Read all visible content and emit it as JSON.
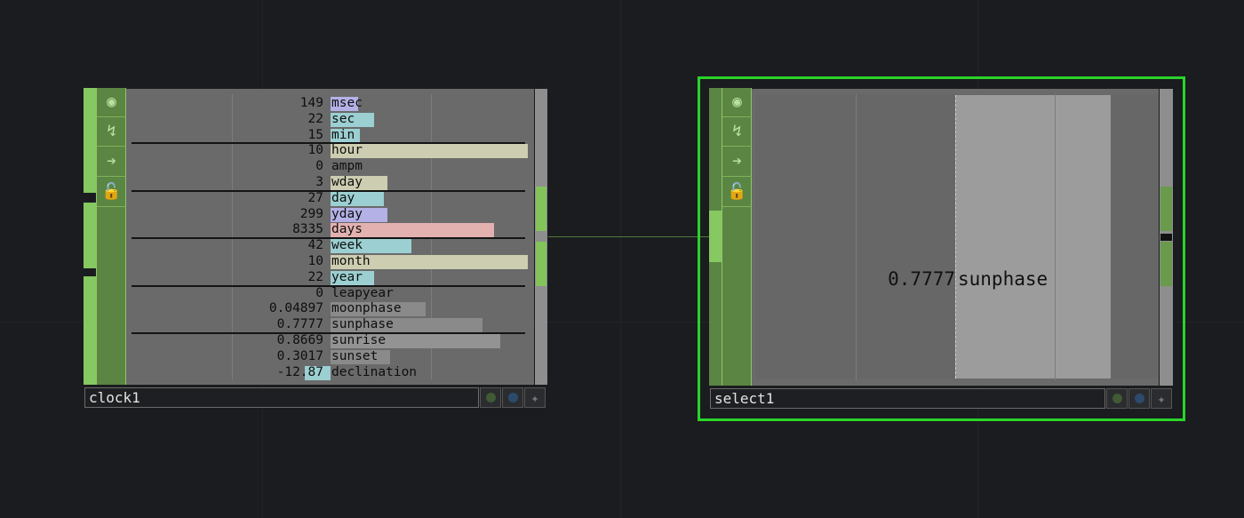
{
  "clock": {
    "name": "clock1",
    "channels": [
      {
        "value": "149",
        "name": "msec",
        "fill": 0.14,
        "color": "#b4b1e6"
      },
      {
        "value": "22",
        "name": "sec",
        "fill": 0.22,
        "color": "#9ccfd1"
      },
      {
        "value": "15",
        "name": "min",
        "fill": 0.15,
        "color": "#9ccfd1"
      },
      {
        "value": "10",
        "name": "hour",
        "fill": 1.0,
        "color": "#cdcdb1"
      },
      {
        "value": "0",
        "name": "ampm",
        "fill": 0.0,
        "color": "#cdcdb1"
      },
      {
        "value": "3",
        "name": "wday",
        "fill": 0.29,
        "color": "#cdcdb1"
      },
      {
        "value": "27",
        "name": "day",
        "fill": 0.27,
        "color": "#9ccfd1"
      },
      {
        "value": "299",
        "name": "yday",
        "fill": 0.29,
        "color": "#b4b1e6"
      },
      {
        "value": "8335",
        "name": "days",
        "fill": 0.83,
        "color": "#e4b1b1"
      },
      {
        "value": "42",
        "name": "week",
        "fill": 0.41,
        "color": "#9ccfd1"
      },
      {
        "value": "10",
        "name": "month",
        "fill": 1.0,
        "color": "#cdcdb1"
      },
      {
        "value": "22",
        "name": "year",
        "fill": 0.22,
        "color": "#9ccfd1"
      },
      {
        "value": "0",
        "name": "leapyear",
        "fill": 0.0,
        "color": "#9ccfd1"
      },
      {
        "value": "0.04897",
        "name": "moonphase",
        "fill": 0.48,
        "color": "#8a8a8a"
      },
      {
        "value": "0.7777",
        "name": "sunphase",
        "fill": 0.77,
        "color": "#8a8a8a"
      },
      {
        "value": "0.8669",
        "name": "sunrise",
        "fill": 0.86,
        "color": "#939393"
      },
      {
        "value": "0.3017",
        "name": "sunset",
        "fill": 0.3,
        "color": "#8a8a8a"
      },
      {
        "value": "-12.87",
        "name": "declination",
        "fill": -0.13,
        "color": "#9ccfd1"
      }
    ]
  },
  "select": {
    "name": "select1",
    "value": "0.7777",
    "channel": "sunphase",
    "fill": 0.7777
  },
  "icons": [
    "viewer-active-icon",
    "cook-icon",
    "arrow-right-icon",
    "lock-icon"
  ],
  "colors": {
    "accent_green": "#86c861",
    "selected_outline": "#2ad42a",
    "viewer_bg": "#6a6a6a",
    "canvas_bg": "#1b1c1f"
  }
}
